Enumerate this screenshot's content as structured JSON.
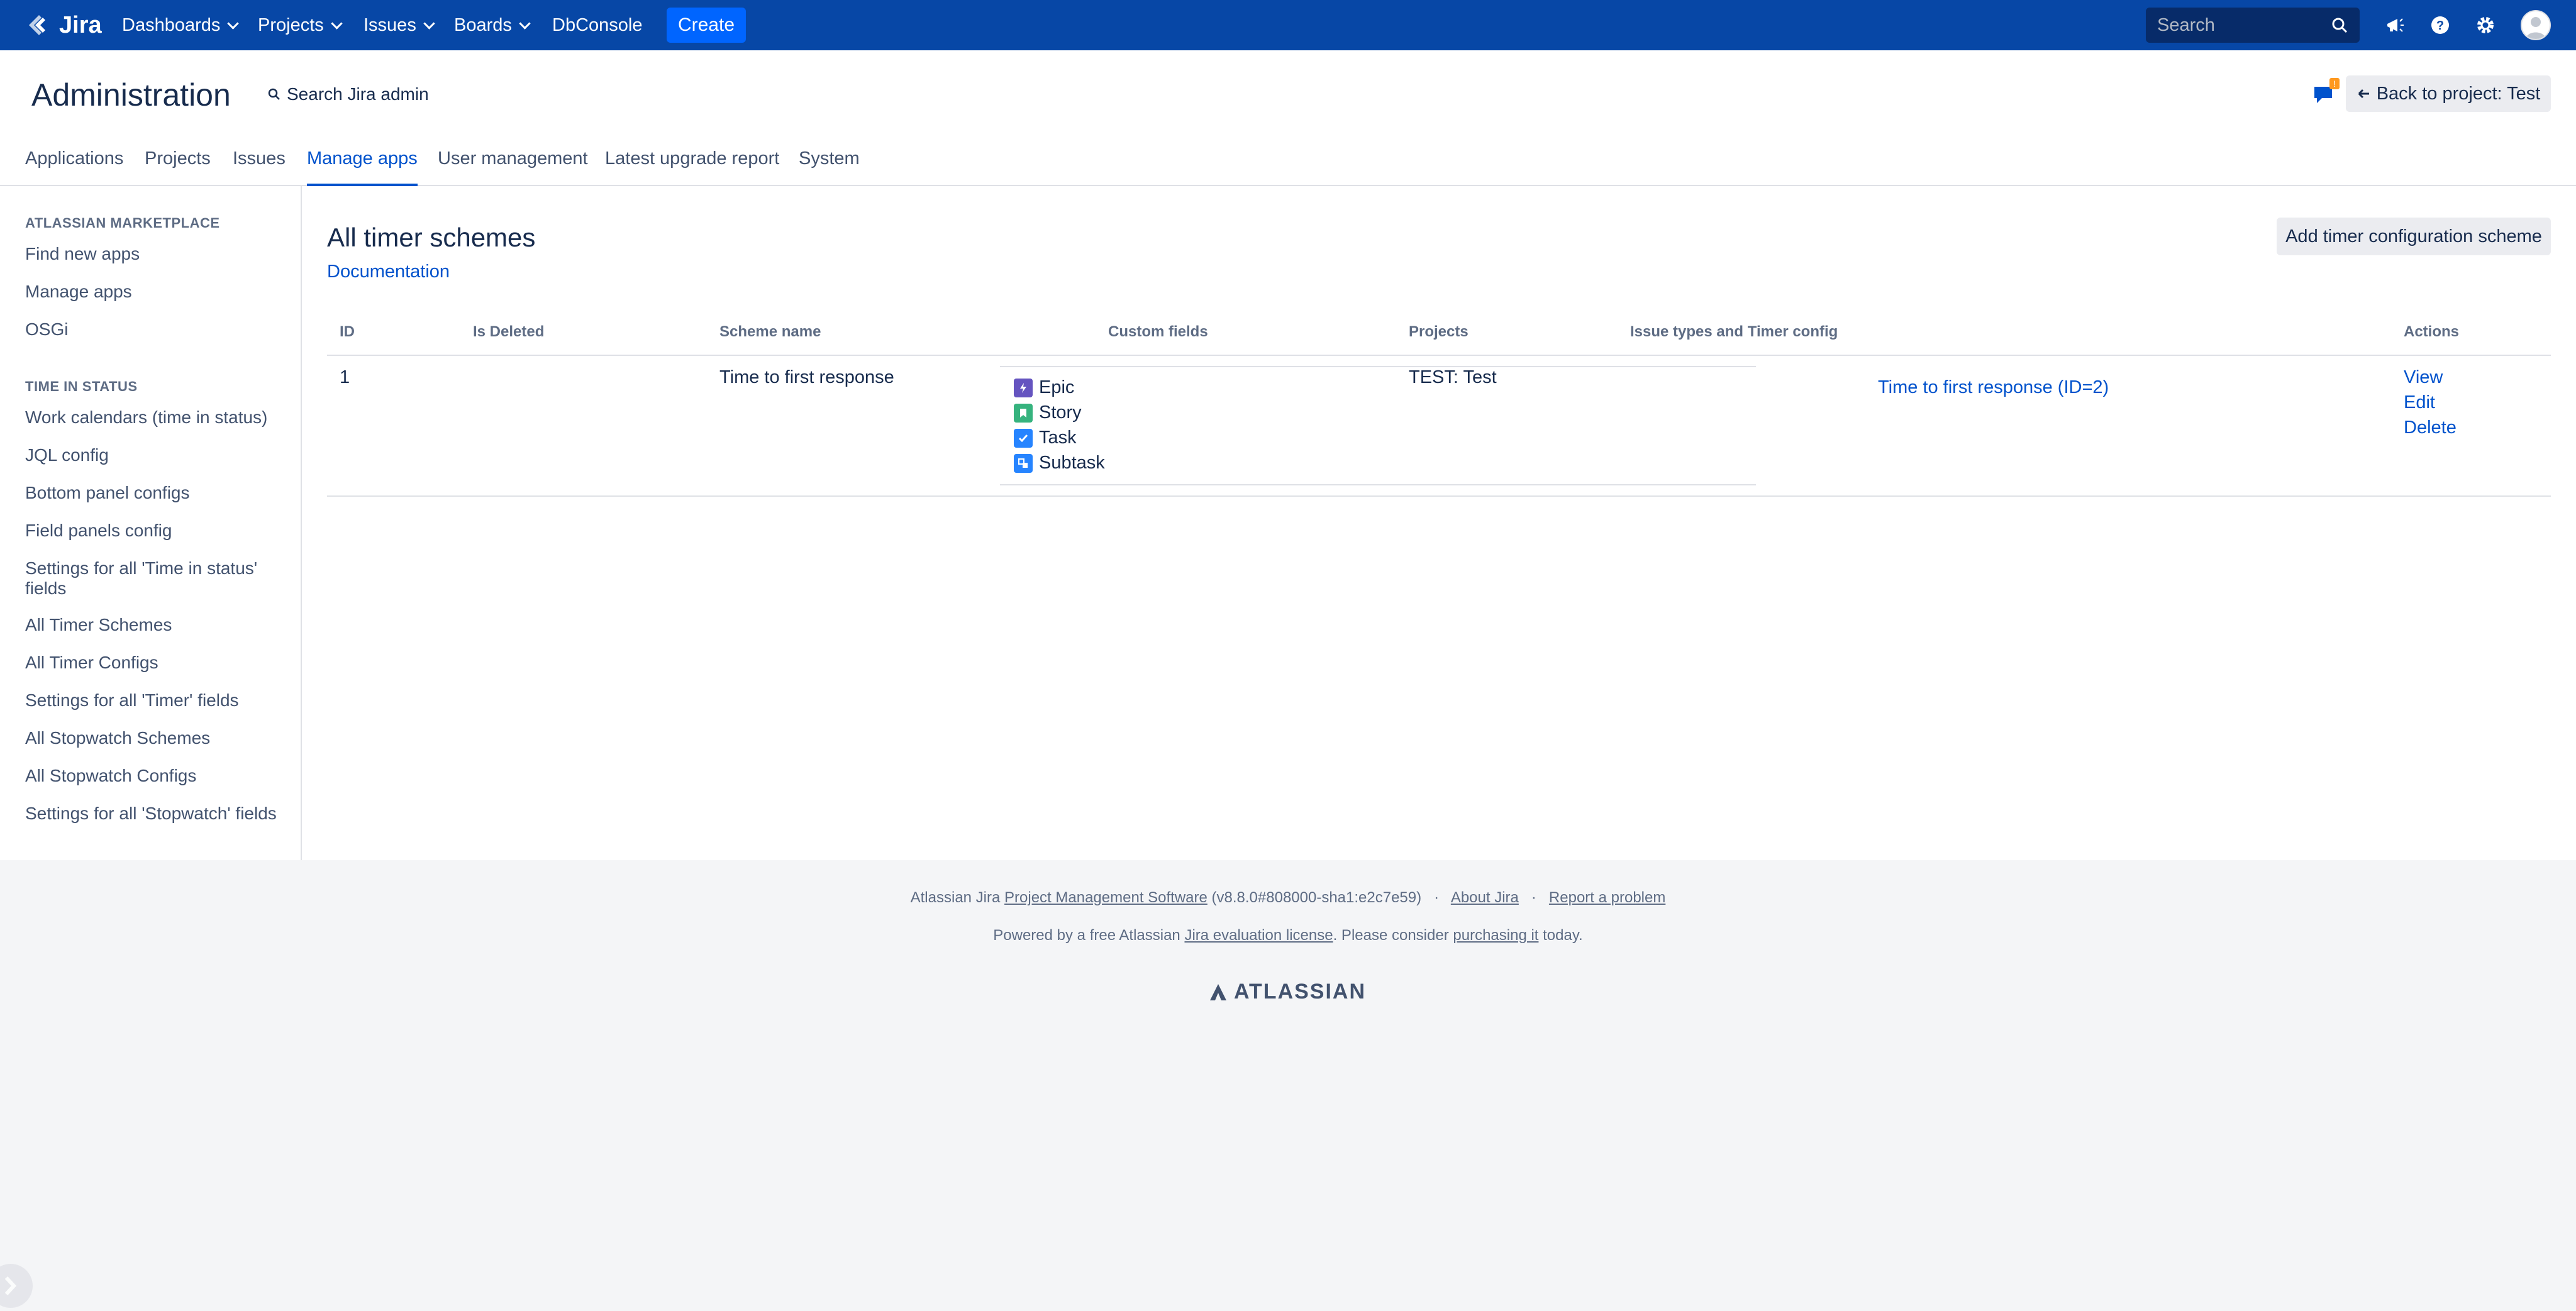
{
  "topnav": {
    "logo_text": "Jira",
    "items": [
      {
        "label": "Dashboards",
        "dropdown": true
      },
      {
        "label": "Projects",
        "dropdown": true
      },
      {
        "label": "Issues",
        "dropdown": true
      },
      {
        "label": "Boards",
        "dropdown": true
      },
      {
        "label": "DbConsole",
        "dropdown": false
      }
    ],
    "create_label": "Create",
    "search_placeholder": "Search",
    "icons": [
      "notifications-icon",
      "help-icon",
      "settings-icon",
      "avatar"
    ]
  },
  "admin": {
    "title": "Administration",
    "search_label": "Search Jira admin",
    "feedback_badge": "!",
    "back_label": "Back to project: Test",
    "tabs": [
      {
        "label": "Applications",
        "active": false
      },
      {
        "label": "Projects",
        "active": false
      },
      {
        "label": "Issues",
        "active": false
      },
      {
        "label": "Manage apps",
        "active": true
      },
      {
        "label": "User management",
        "active": false
      },
      {
        "label": "Latest upgrade report",
        "active": false
      },
      {
        "label": "System",
        "active": false
      }
    ]
  },
  "sidebar": {
    "sections": [
      {
        "heading": "ATLASSIAN MARKETPLACE",
        "items": [
          "Find new apps",
          "Manage apps",
          "OSGi"
        ]
      },
      {
        "heading": "TIME IN STATUS",
        "items": [
          "Work calendars (time in status)",
          "JQL config",
          "Bottom panel configs",
          "Field panels config",
          "Settings for all 'Time in status' fields",
          "All Timer Schemes",
          "All Timer Configs",
          "Settings for all 'Timer' fields",
          "All Stopwatch Schemes",
          "All Stopwatch Configs",
          "Settings for all 'Stopwatch' fields"
        ]
      }
    ]
  },
  "main": {
    "title": "All timer schemes",
    "doc_link": "Documentation",
    "add_button": "Add timer configuration scheme",
    "columns": [
      "ID",
      "Is Deleted",
      "Scheme name",
      "Custom fields",
      "Projects",
      "Issue types and Timer config",
      "Actions"
    ],
    "rows": [
      {
        "id": "1",
        "is_deleted": "",
        "scheme_name": "Time to first response",
        "custom_fields": "",
        "projects": "TEST: Test",
        "issue_types": [
          {
            "name": "Epic",
            "color": "#6554c0",
            "icon": "epic-icon"
          },
          {
            "name": "Story",
            "color": "#36b37e",
            "icon": "story-icon"
          },
          {
            "name": "Task",
            "color": "#2684ff",
            "icon": "task-icon"
          },
          {
            "name": "Subtask",
            "color": "#2684ff",
            "icon": "subtask-icon"
          }
        ],
        "timer_config": "Time to first response (ID=2)",
        "actions": [
          "View",
          "Edit",
          "Delete"
        ]
      }
    ]
  },
  "footer": {
    "line1_prefix": "Atlassian Jira",
    "line1_link": "Project Management Software",
    "line1_version": "(v8.8.0#808000-sha1:e2c7e59)",
    "sep": "·",
    "about": "About Jira",
    "report": "Report a problem",
    "line2_prefix": "Powered by a free Atlassian",
    "line2_link": "Jira evaluation license",
    "line2_mid": ". Please consider",
    "line2_link2": "purchasing it",
    "line2_suffix": "today.",
    "brand": "ATLASSIAN"
  }
}
